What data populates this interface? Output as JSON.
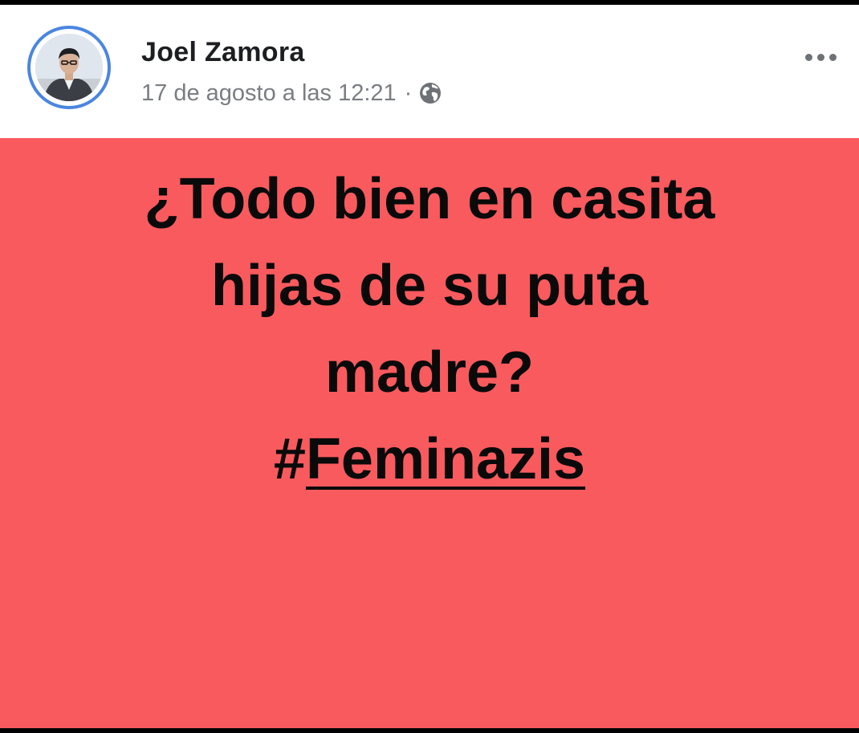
{
  "post": {
    "author": "Joel Zamora",
    "timestamp": "17 de agosto a las 12:21",
    "separator": "·",
    "privacy_icon": "globe-icon",
    "more_icon": "more-options-icon",
    "text_lines": [
      "¿Todo bien en casita",
      "hijas de su puta",
      "madre?"
    ],
    "hashtag_symbol": "#",
    "hashtag_word": "Feminazis"
  },
  "colors": {
    "post_background": "#f95a5e",
    "avatar_ring": "#4a86e0",
    "meta_text": "#7a7d82",
    "author_text": "#1c1e21"
  }
}
